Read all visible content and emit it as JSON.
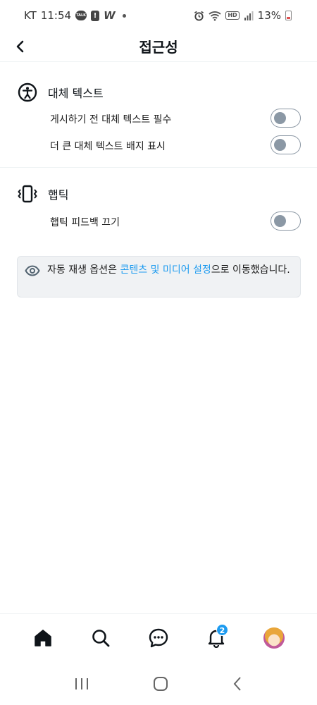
{
  "status_bar": {
    "carrier": "KT",
    "time": "11:54",
    "talk_badge": "TALK",
    "notification_badge": "!",
    "w_label": "W",
    "hd_label": "HD",
    "battery_percent": "13%"
  },
  "header": {
    "title": "접근성"
  },
  "alt_text": {
    "title": "대체 텍스트",
    "require_alt_text_label": "게시하기 전 대체 텍스트 필수",
    "larger_badge_label": "더 큰 대체 텍스트 배지 표시"
  },
  "haptics": {
    "title": "햅틱",
    "disable_feedback_label": "햅틱 피드백 끄기"
  },
  "notice": {
    "text_before": "자동 재생 옵션은 ",
    "link_text": "콘텐츠 및 미디어 설정",
    "text_after": "으로 이동했습니다."
  },
  "toggles": {
    "require_alt_text": false,
    "larger_badge": false,
    "disable_haptics": false
  },
  "tab_bar": {
    "notification_count": "2"
  },
  "colors": {
    "accent": "#1d9bf0",
    "toggle_off": "#8b98a5",
    "notice_bg": "#f0f2f4"
  }
}
